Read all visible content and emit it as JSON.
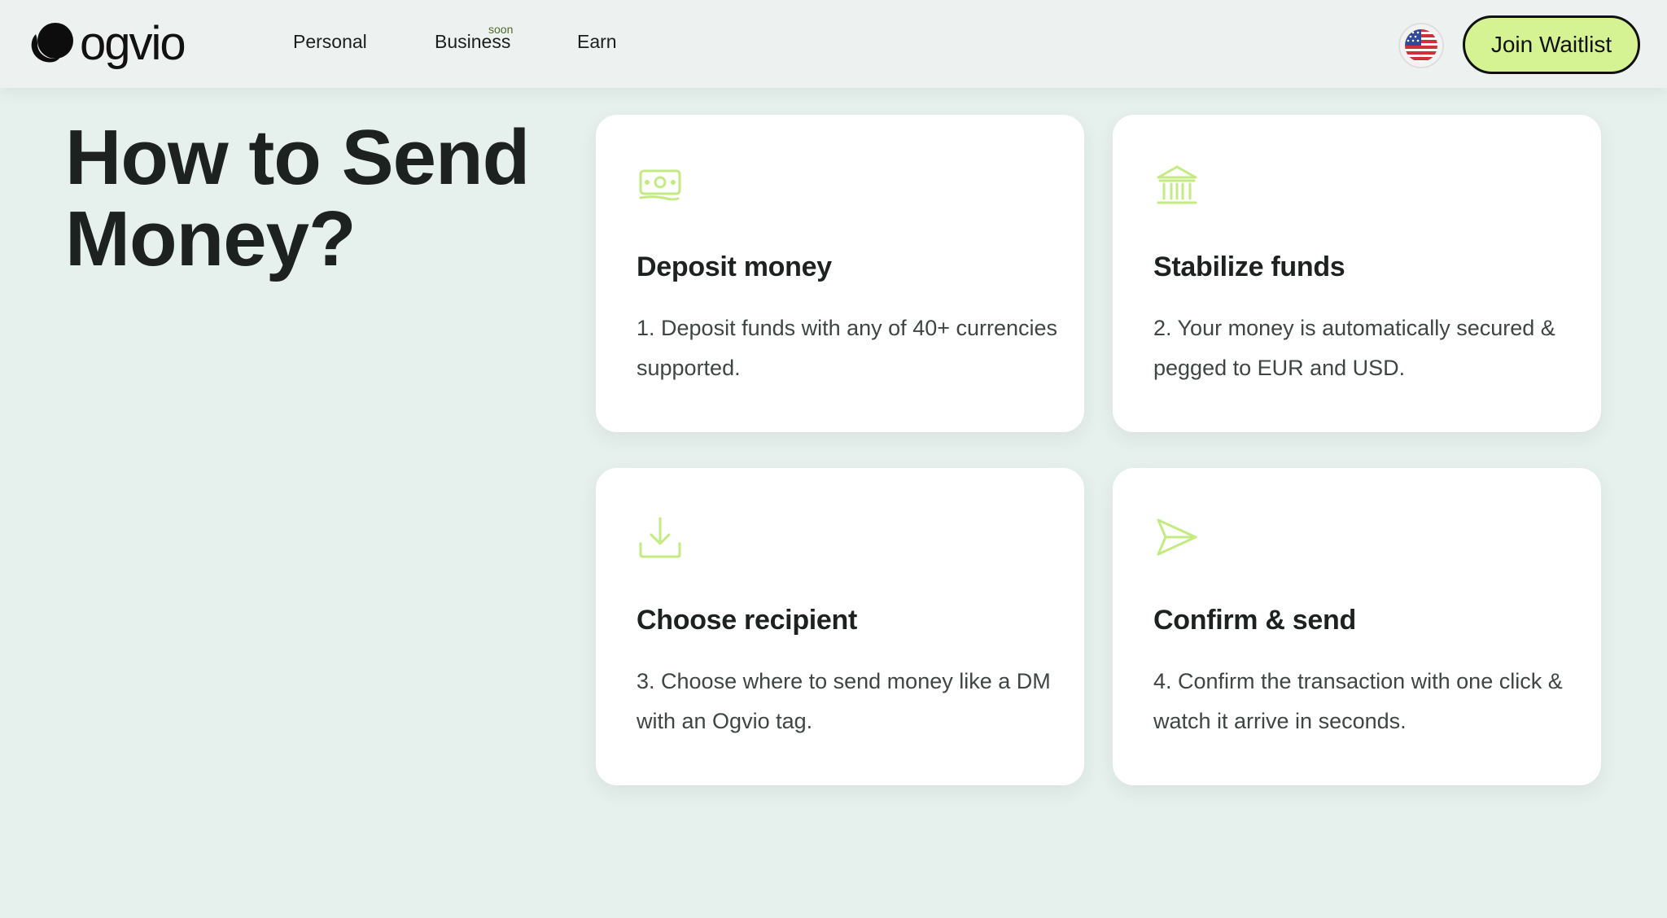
{
  "brand": {
    "name": "ogvio"
  },
  "nav": {
    "items": [
      {
        "label": "Personal"
      },
      {
        "label": "Business",
        "badge": "soon"
      },
      {
        "label": "Earn"
      }
    ],
    "cta_label": "Join Waitlist",
    "language_icon": "us-flag-icon"
  },
  "main": {
    "heading_line1": "How to Send",
    "heading_line2": "Money?",
    "accent_color": "#c4ea82",
    "cards": [
      {
        "icon": "banknote-icon",
        "title": "Deposit money",
        "text": "1. Deposit funds with any of 40+ currencies supported."
      },
      {
        "icon": "bank-icon",
        "title": "Stabilize funds",
        "text": "2. Your money is automatically secured & pegged to EUR and USD."
      },
      {
        "icon": "download-icon",
        "title": "Choose recipient",
        "text": "3. Choose where to send money like a DM with an Ogvio tag."
      },
      {
        "icon": "send-icon",
        "title": "Confirm & send",
        "text": "4. Confirm the transaction with one click & watch it arrive in seconds."
      }
    ]
  }
}
